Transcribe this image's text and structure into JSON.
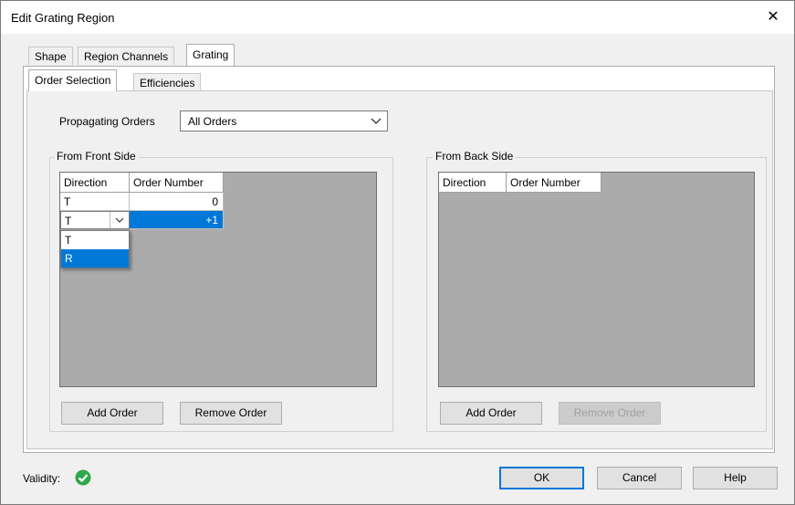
{
  "window": {
    "title": "Edit Grating Region",
    "close_symbol": "✕"
  },
  "tabs": [
    "Shape",
    "Region Channels",
    "Grating"
  ],
  "subtabs": [
    "Order Selection",
    "Efficiencies"
  ],
  "propagating": {
    "label": "Propagating Orders",
    "value": "All Orders"
  },
  "front": {
    "title": "From Front Side",
    "headers": [
      "Direction",
      "Order Number"
    ],
    "rows": [
      {
        "direction": "T",
        "order": "0"
      },
      {
        "direction": "T",
        "order": "+1"
      }
    ],
    "dropdown_options": [
      "T",
      "R"
    ],
    "dropdown_selected": "R",
    "add_label": "Add Order",
    "remove_label": "Remove Order"
  },
  "back": {
    "title": "From Back Side",
    "headers": [
      "Direction",
      "Order Number"
    ],
    "add_label": "Add Order",
    "remove_label": "Remove Order"
  },
  "footer": {
    "validity_label": "Validity:",
    "validity_status": "valid",
    "ok": "OK",
    "cancel": "Cancel",
    "help": "Help"
  },
  "colors": {
    "accent": "#0078d7",
    "valid_green": "#2ea84a",
    "grid_bg": "#ababab"
  }
}
